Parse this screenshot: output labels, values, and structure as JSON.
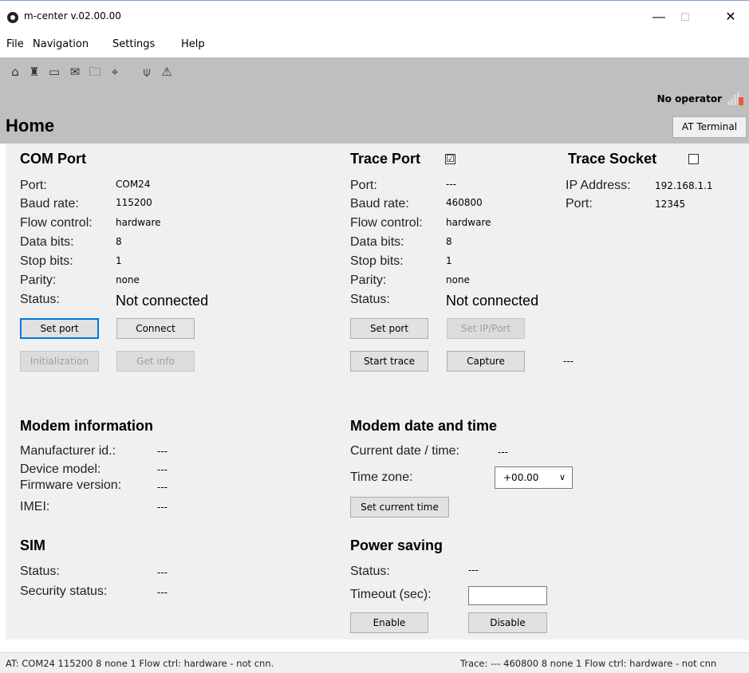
{
  "window": {
    "title": "m-center v.02.00.00",
    "minimize": "—",
    "maximize": "☐",
    "close": "✕"
  },
  "menu": [
    "File",
    "Navigation",
    "Settings",
    "Help"
  ],
  "toolbar": {
    "icons": [
      "home-icon",
      "tower-icon",
      "device-icon",
      "mail-icon",
      "folder-icon",
      "satellite-icon",
      "antenna-icon",
      "warning-icon"
    ],
    "glyphs": [
      "⌂",
      "♜",
      "▭",
      "✉",
      "🗀",
      "⌖",
      "⍦",
      "⚠"
    ],
    "operator": "No operator",
    "signal_color": "#e85a3a"
  },
  "page": {
    "title": "Home",
    "at_terminal": "AT Terminal"
  },
  "com_port": {
    "title": "COM Port",
    "labels": [
      "Port:",
      "Baud rate:",
      "Flow control:",
      "Data bits:",
      "Stop bits:",
      "Parity:",
      "Status:"
    ],
    "values": [
      "COM24",
      "115200",
      "hardware",
      "8",
      "1",
      "none"
    ],
    "status": "Not connected",
    "set_port": "Set port",
    "connect": "Connect",
    "initialization": "Initialization",
    "get_info": "Get info"
  },
  "trace_port": {
    "title": "Trace Port",
    "checked": "☑",
    "labels": [
      "Port:",
      "Baud rate:",
      "Flow control:",
      "Data bits:",
      "Stop bits:",
      "Parity:",
      "Status:"
    ],
    "values": [
      "---",
      "460800",
      "hardware",
      "8",
      "1",
      "none"
    ],
    "status": "Not connected",
    "set_port": "Set port",
    "set_ip_port": "Set IP/Port",
    "start_trace": "Start trace",
    "capture": "Capture",
    "capture_status": "---"
  },
  "trace_socket": {
    "title": "Trace Socket",
    "ip_label": "IP Address:",
    "ip_value": "192.168.1.1",
    "port_label": "Port:",
    "port_value": "12345"
  },
  "modem_info": {
    "title": "Modem information",
    "manufacturer_label": "Manufacturer id.:",
    "manufacturer_value": "---",
    "model_label": "Device model:",
    "model_value": "---",
    "firmware_label": "Firmware version:",
    "firmware_value": "---",
    "imei_label": "IMEI:",
    "imei_value": "---"
  },
  "modem_time": {
    "title": "Modem date and time",
    "current_label": "Current date / time:",
    "current_value": "---",
    "tz_label": "Time zone:",
    "tz_value": "+00.00",
    "set_time": "Set current time"
  },
  "sim": {
    "title": "SIM",
    "status_label": "Status:",
    "status_value": "---",
    "security_label": "Security status:",
    "security_value": "---"
  },
  "power": {
    "title": "Power saving",
    "status_label": "Status:",
    "status_value": "---",
    "timeout_label": "Timeout (sec):",
    "timeout_value": "",
    "enable": "Enable",
    "disable": "Disable"
  },
  "statusbar": {
    "at": "AT: COM24 115200 8 none 1 Flow ctrl: hardware - not cnn.",
    "trace": "Trace: --- 460800 8 none 1 Flow ctrl: hardware - not cnn"
  }
}
